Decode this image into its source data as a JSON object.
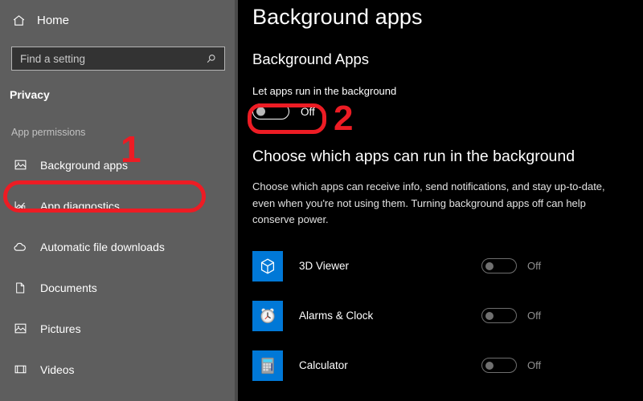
{
  "sidebar": {
    "home": {
      "label": "Home",
      "icon": "home-icon"
    },
    "search": {
      "placeholder": "Find a setting",
      "value": "",
      "icon": "search-icon"
    },
    "category": "Privacy",
    "section_label": "App permissions",
    "items": [
      {
        "label": "Background apps",
        "icon": "picture-icon",
        "selected": true
      },
      {
        "label": "App diagnostics",
        "icon": "chart-icon",
        "selected": false
      },
      {
        "label": "Automatic file downloads",
        "icon": "cloud-icon",
        "selected": false
      },
      {
        "label": "Documents",
        "icon": "document-icon",
        "selected": false
      },
      {
        "label": "Pictures",
        "icon": "picture-icon",
        "selected": false
      },
      {
        "label": "Videos",
        "icon": "film-icon",
        "selected": false
      }
    ]
  },
  "main": {
    "page_title": "Background apps",
    "sub_title": "Background Apps",
    "master_toggle": {
      "label": "Let apps run in the background",
      "state": "Off",
      "on": false
    },
    "section_head": "Choose which apps can run in the background",
    "description": "Choose which apps can receive info, send notifications, and stay up-to-date, even when you're not using them. Turning background apps off can help conserve power.",
    "apps": [
      {
        "name": "3D Viewer",
        "icon": "cube-icon",
        "state": "Off",
        "on": false
      },
      {
        "name": "Alarms & Clock",
        "icon": "alarm-clock-icon",
        "state": "Off",
        "on": false
      },
      {
        "name": "Calculator",
        "icon": "calculator-icon",
        "state": "Off",
        "on": false
      }
    ]
  },
  "annotations": {
    "marker_one": "1",
    "marker_two": "2",
    "color": "#ed1c24"
  },
  "colors": {
    "sidebar_bg": "#5e5e5e",
    "panel_bg": "#000000",
    "tile_blue": "#0078d7",
    "annotation_red": "#ed1c24"
  }
}
